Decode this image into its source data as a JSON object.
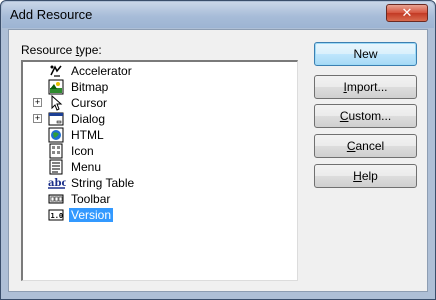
{
  "window": {
    "title": "Add Resource",
    "close_label": "✕"
  },
  "label": {
    "prefix": "Resource ",
    "underline": "t",
    "suffix": "ype:"
  },
  "tree": {
    "items": [
      {
        "label": "Accelerator",
        "icon": "accelerator-icon",
        "expandable": false,
        "selected": false
      },
      {
        "label": "Bitmap",
        "icon": "bitmap-icon",
        "expandable": false,
        "selected": false
      },
      {
        "label": "Cursor",
        "icon": "cursor-icon",
        "expandable": true,
        "selected": false
      },
      {
        "label": "Dialog",
        "icon": "dialog-icon",
        "expandable": true,
        "selected": false
      },
      {
        "label": "HTML",
        "icon": "html-icon",
        "expandable": false,
        "selected": false
      },
      {
        "label": "Icon",
        "icon": "icon-resource-icon",
        "expandable": false,
        "selected": false
      },
      {
        "label": "Menu",
        "icon": "menu-icon",
        "expandable": false,
        "selected": false
      },
      {
        "label": "String Table",
        "icon": "string-table-icon",
        "expandable": false,
        "selected": false
      },
      {
        "label": "Toolbar",
        "icon": "toolbar-icon",
        "expandable": false,
        "selected": false
      },
      {
        "label": "Version",
        "icon": "version-icon",
        "expandable": false,
        "selected": true
      }
    ],
    "expander_symbol": "+"
  },
  "buttons": {
    "new": "New",
    "import": {
      "pre": "",
      "u": "I",
      "post": "mport..."
    },
    "custom": {
      "pre": "",
      "u": "C",
      "post": "ustom..."
    },
    "cancel": {
      "pre": "",
      "u": "C",
      "post": "ancel"
    },
    "help": {
      "pre": "",
      "u": "H",
      "post": "elp"
    }
  },
  "icon_text": {
    "string_table": "abc",
    "version": "1.0"
  }
}
